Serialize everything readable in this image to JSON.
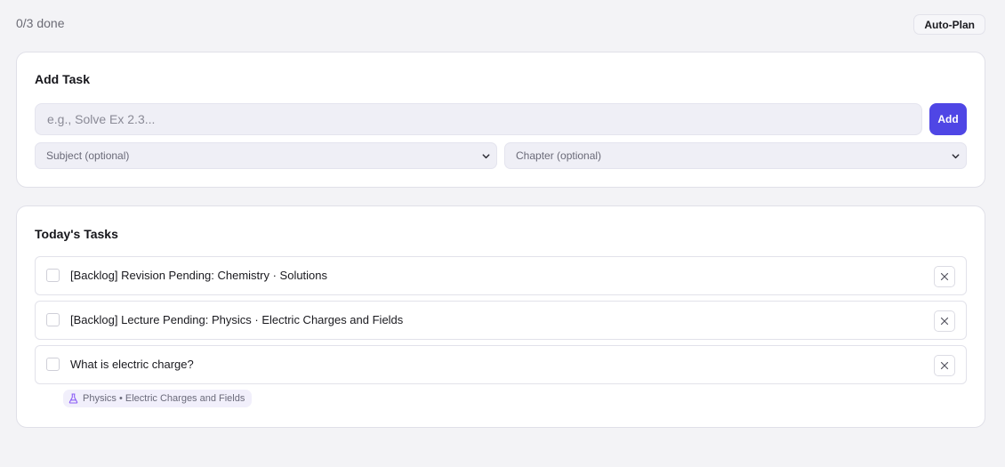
{
  "header": {
    "progress": "0/3 done",
    "auto_plan_label": "Auto-Plan"
  },
  "add_task": {
    "title": "Add Task",
    "input_placeholder": "e.g., Solve Ex 2.3...",
    "add_label": "Add",
    "subject_select": {
      "selected": "Subject (optional)"
    },
    "chapter_select": {
      "selected": "Chapter (optional)"
    }
  },
  "tasks": {
    "title": "Today's Tasks",
    "items": [
      {
        "text": "[Backlog] Revision Pending: Chemistry · Solutions",
        "done": false
      },
      {
        "text": "[Backlog] Lecture Pending: Physics · Electric Charges and Fields",
        "done": false
      },
      {
        "text": "What is electric charge?",
        "done": false,
        "tag": "Physics • Electric Charges and Fields",
        "tag_icon": "flask-icon"
      }
    ]
  },
  "colors": {
    "accent": "#4f46e5",
    "background": "#f3f3f6",
    "card": "#ffffff",
    "tag_background": "#f1effb",
    "tag_icon": "#8b5cf6"
  }
}
